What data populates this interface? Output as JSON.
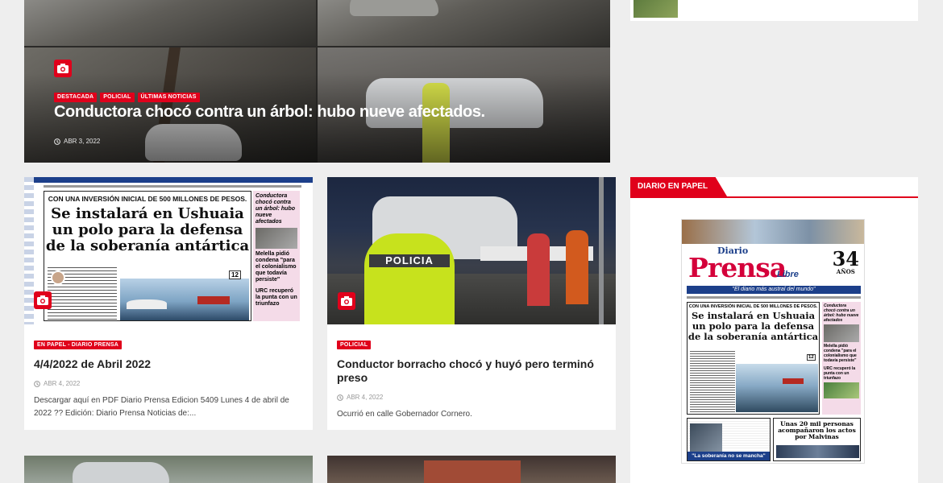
{
  "hero": {
    "badges": [
      "DESTACADA",
      "POLICIAL",
      "ÚLTIMAS NOTICIAS"
    ],
    "title": "Conductora chocó contra un árbol: hubo nueve afectados.",
    "date": "ABR 3, 2022"
  },
  "cards": [
    {
      "badge": "EN PAPEL - DIARIO PRENSA",
      "title": "4/4/2022 de Abril 2022",
      "date": "ABR 4, 2022",
      "excerpt": "Descargar aquí en PDF Diario Prensa Edicion 5409 Lunes 4 de abril de 2022 ?? Edición: Diario Prensa Noticias de:..."
    },
    {
      "badge": "POLICIAL",
      "title": "Conductor borracho chocó y huyó pero terminó preso",
      "date": "ABR 4, 2022",
      "excerpt": "Ocurrió en calle Gobernador Cornero."
    }
  ],
  "newspaper": {
    "banner": "CON UNA INVERSIÓN INICIAL DE 500 MILLONES DE PESOS.",
    "headline_line1": "Se instalará en Ushuaia",
    "headline_line2": "un polo para la defensa",
    "headline_line3": "de la soberanía antártica",
    "side1": "Conductora chocó contra un árbol: hubo nueve afectados",
    "side2": "Melella pidió condena \"para el colonialismo que todavía persiste\"",
    "side3": "URC recuperó la punta con un triunfazo",
    "page_ref": "12",
    "police_vest": "POLICIA",
    "masthead_diario": "Diario",
    "masthead_prensa": "Prensa",
    "masthead_libre": "Libre",
    "masthead_years": "34",
    "masthead_anos": "AÑOS",
    "slogan": "\"El diario más austral del mundo\"",
    "bottom_story": "Unas 20 mil personas acompañaron los actos por Malvinas",
    "bottom_quote": "\"La soberanía no se mancha\""
  },
  "sidebar": {
    "widget_title": "DIARIO EN PAPEL"
  },
  "colors": {
    "accent": "#e0001b",
    "background": "#eeeeee"
  }
}
